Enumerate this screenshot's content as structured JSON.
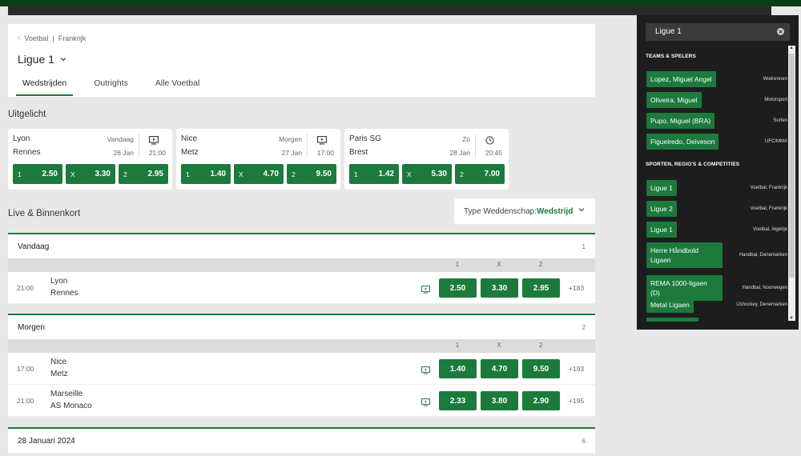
{
  "header": {
    "breadcrumb": [
      "Voetbal",
      "|",
      "Frankrijk"
    ],
    "title": "Ligue 1",
    "tabs": [
      "Wedstrijden",
      "Outrights",
      "Alle Voetbal"
    ]
  },
  "featured": {
    "title": "Uitgelicht",
    "cards": [
      {
        "home": "Lyon",
        "away": "Rennes",
        "day": "Vandaag",
        "date": "26 Jan",
        "time": "21:00",
        "icon": "tv-icon",
        "odds": [
          {
            "label": "1",
            "value": "2.50"
          },
          {
            "label": "X",
            "value": "3.30"
          },
          {
            "label": "2",
            "value": "2.95"
          }
        ]
      },
      {
        "home": "Nice",
        "away": "Metz",
        "day": "Morgen",
        "date": "27 Jan",
        "time": "17:00",
        "icon": "tv-icon",
        "odds": [
          {
            "label": "1",
            "value": "1.40"
          },
          {
            "label": "X",
            "value": "4.70"
          },
          {
            "label": "2",
            "value": "9.50"
          }
        ]
      },
      {
        "home": "Paris SG",
        "away": "Brest",
        "day": "Zo",
        "date": "28 Jan",
        "time": "20:45",
        "icon": "clock-icon",
        "odds": [
          {
            "label": "1",
            "value": "1.42"
          },
          {
            "label": "X",
            "value": "5.30"
          },
          {
            "label": "2",
            "value": "7.00"
          }
        ]
      }
    ]
  },
  "live": {
    "title": "Live & Binnenkort",
    "bet_type_label": "Type Weddenschap:",
    "bet_type_value": "Wedstrijd",
    "columns": [
      "1",
      "X",
      "2"
    ],
    "groups": [
      {
        "name": "Vandaag",
        "count": "1",
        "rows": [
          {
            "time": "21:00",
            "home": "Lyon",
            "away": "Rennes",
            "odds": [
              "2.50",
              "3.30",
              "2.95"
            ],
            "more": "+183"
          }
        ]
      },
      {
        "name": "Morgen",
        "count": "2",
        "rows": [
          {
            "time": "17:00",
            "home": "Nice",
            "away": "Metz",
            "odds": [
              "1.40",
              "4.70",
              "9.50"
            ],
            "more": "+193"
          },
          {
            "time": "21:00",
            "home": "Marseille",
            "away": "AS Monaco",
            "odds": [
              "2.33",
              "3.80",
              "2.90"
            ],
            "more": "+195"
          }
        ]
      },
      {
        "name": "28 Januari 2024",
        "count": "6",
        "rows": []
      }
    ]
  },
  "search": {
    "query": "Ligue 1",
    "sections": [
      {
        "title": "TEAMS & SPELERS",
        "items": [
          {
            "label": "Lopez, Miguel Angel",
            "category": "Wielrennen"
          },
          {
            "label": "Oliveira, Miguel",
            "category": "Motorsport"
          },
          {
            "label": "Pupo, Miguel (BRA)",
            "category": "Surfen"
          },
          {
            "label": "Figueiredo, Deiveson",
            "category": "UFC/MMA"
          }
        ]
      },
      {
        "title": "SPORTEN, REGIO'S & COMPETITIES",
        "items": [
          {
            "label": "Ligue 1",
            "category": "Voetbal, Frankrijk"
          },
          {
            "label": "Ligue 2",
            "category": "Voetbal, Frankrijk"
          },
          {
            "label": "Ligue 1",
            "category": "Voetbal, Algerije"
          },
          {
            "label": "Herre Håndbold Ligaen",
            "category": "Handbal, Denemarken"
          },
          {
            "label": "REMA 1000-ligaen (D)",
            "category": "Handbal, Noorwegen"
          },
          {
            "label": "Metal Ligaen",
            "category": "IJshockey, Denemarken"
          }
        ]
      }
    ]
  },
  "colors": {
    "accent": "#1c7a3c",
    "topbar": "#0b3d16",
    "dropdown_bg": "#1d1d1d"
  }
}
